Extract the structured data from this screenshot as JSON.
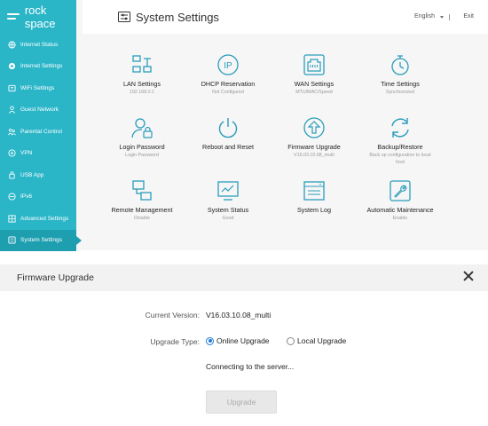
{
  "app": {
    "logo_text": "rock space"
  },
  "sidebar": {
    "items": [
      {
        "label": "Internet Status",
        "icon": "globe-icon"
      },
      {
        "label": "Internet Settings",
        "icon": "network-icon"
      },
      {
        "label": "WiFi Settings",
        "icon": "wifi-icon"
      },
      {
        "label": "Guest Network",
        "icon": "guest-icon"
      },
      {
        "label": "Parental Control",
        "icon": "family-icon"
      },
      {
        "label": "VPN",
        "icon": "vpn-icon"
      },
      {
        "label": "USB App",
        "icon": "usb-icon"
      },
      {
        "label": "IPv6",
        "icon": "ipv6-icon"
      },
      {
        "label": "Advanced Settings",
        "icon": "grid-icon"
      },
      {
        "label": "System Settings",
        "icon": "settings-list-icon",
        "active": true
      }
    ]
  },
  "header": {
    "title": "System Settings",
    "language": "English",
    "separator": "|",
    "exit": "Exit"
  },
  "tiles": [
    {
      "label": "LAN Settings",
      "sub": "192.168.0.1",
      "icon": "lan-icon"
    },
    {
      "label": "DHCP Reservation",
      "sub": "Not Configured",
      "icon": "ip-icon"
    },
    {
      "label": "WAN Settings",
      "sub": "MTU/MAC/Speed",
      "icon": "ethernet-port-icon"
    },
    {
      "label": "Time Settings",
      "sub": "Synchronized",
      "icon": "stopwatch-icon"
    },
    {
      "label": "Login Password",
      "sub": "Login Password",
      "icon": "user-lock-icon"
    },
    {
      "label": "Reboot and Reset",
      "sub": "",
      "icon": "power-icon"
    },
    {
      "label": "Firmware Upgrade",
      "sub": "V16.03.10.08_multi",
      "icon": "upload-shield-icon"
    },
    {
      "label": "Backup/Restore",
      "sub": "Back up configuration to local host",
      "icon": "refresh-icon"
    },
    {
      "label": "Remote Management",
      "sub": "Disable",
      "icon": "remote-icon"
    },
    {
      "label": "System Status",
      "sub": "Good",
      "icon": "monitor-chart-icon"
    },
    {
      "label": "System Log",
      "sub": "",
      "icon": "log-window-icon"
    },
    {
      "label": "Automatic Maintenance",
      "sub": "Enable",
      "icon": "wrench-icon"
    }
  ],
  "dialog": {
    "title": "Firmware Upgrade",
    "close_icon": "close-icon",
    "current_version_label": "Current Version:",
    "current_version_value": "V16.03.10.08_multi",
    "upgrade_type_label": "Upgrade Type:",
    "option_online": "Online Upgrade",
    "option_local": "Local Upgrade",
    "selected_option": "Online Upgrade",
    "status_text": "Connecting to the server...",
    "upgrade_button": "Upgrade"
  },
  "colors": {
    "sidebar": "#2bb6c8",
    "sidebar_active": "#1e9fb0",
    "radio_selected": "#1f7bd8"
  }
}
